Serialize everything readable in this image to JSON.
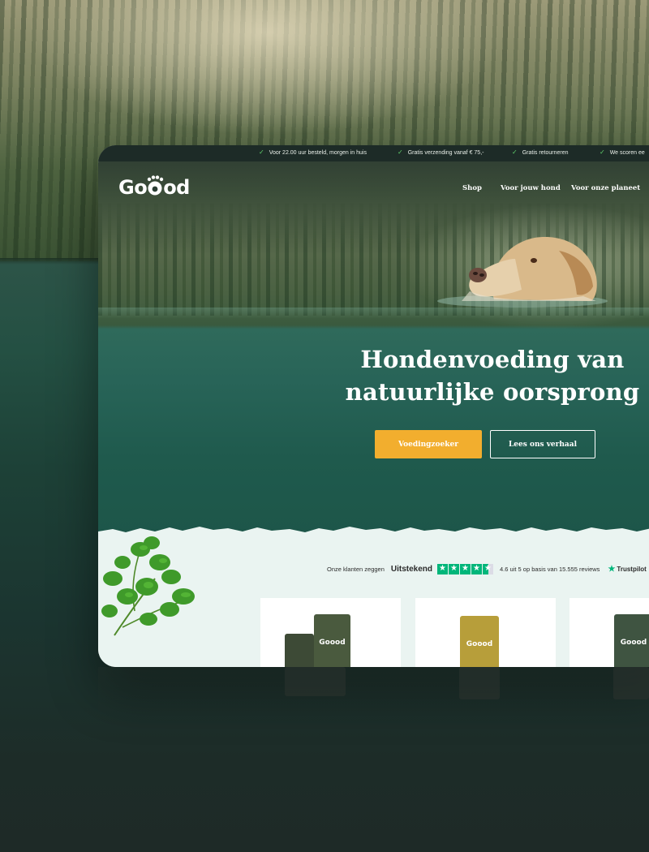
{
  "topbar": {
    "usps": [
      "Voor 22.00 uur besteld, morgen in huis",
      "Gratis verzending vanaf € 75,-",
      "Gratis retourneren",
      "We scoren ee"
    ]
  },
  "brand": {
    "logo_start": "Go",
    "logo_end": "od"
  },
  "nav": {
    "items": [
      "Shop",
      "Voor jouw hond",
      "Voor onze planeet"
    ]
  },
  "hero": {
    "headline_line1": "Hondenvoeding van",
    "headline_line2": "natuurlijke oorsprong",
    "primary_button": "Voedingzoeker",
    "secondary_button": "Lees ons verhaal"
  },
  "trustpilot": {
    "intro": "Onze klanten zeggen",
    "rating_word": "Uitstekend",
    "stars": 4.6,
    "summary": "4.6 uit 5 op basis van 15.555 reviews",
    "logo": "Trustpilot"
  },
  "products": {
    "bag_brand": "Goood"
  },
  "colors": {
    "accent": "#f2ae2e",
    "topbar": "#1d2b27",
    "check": "#5fcf6b",
    "trustpilot": "#00b67a",
    "content_bg": "#eaf4f1"
  }
}
